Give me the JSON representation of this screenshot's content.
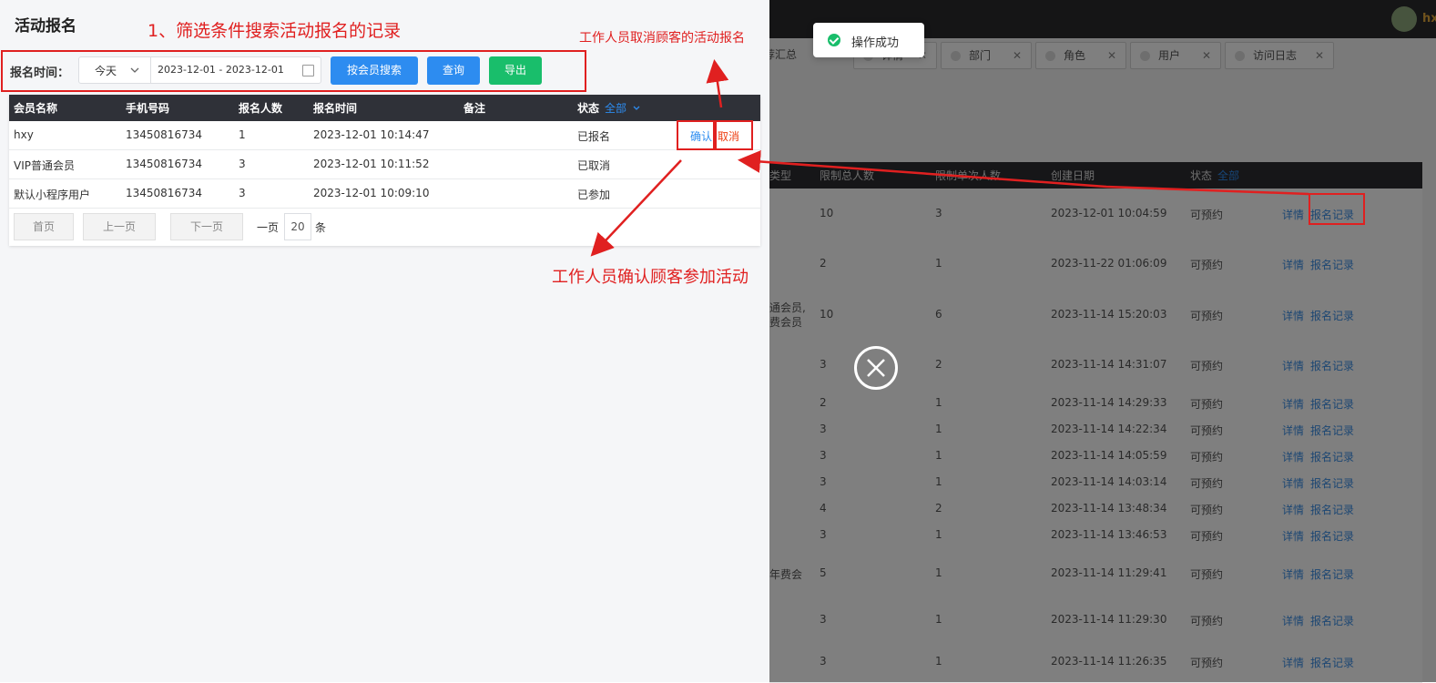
{
  "background_app": {
    "user_label": "hx",
    "toast_text": "操作成功",
    "tabs": [
      {
        "label": "荐汇总",
        "closable": false
      },
      {
        "label": "详情",
        "closable": true
      },
      {
        "label": "部门",
        "closable": true
      },
      {
        "label": "角色",
        "closable": true
      },
      {
        "label": "用户",
        "closable": true
      },
      {
        "label": "访问日志",
        "closable": true
      }
    ],
    "columns": [
      "类型",
      "限制总人数",
      "限制单次人数",
      "创建日期",
      "状态",
      "全部"
    ],
    "rows": [
      {
        "type": "",
        "total": "10",
        "single": "3",
        "date": "2023-12-01 10:04:59",
        "status": "可预约"
      },
      {
        "type": "",
        "total": "2",
        "single": "1",
        "date": "2023-11-22 01:06:09",
        "status": "可预约"
      },
      {
        "type": "通会员,\n费会员",
        "total": "10",
        "single": "6",
        "date": "2023-11-14 15:20:03",
        "status": "可预约"
      },
      {
        "type": "",
        "total": "3",
        "single": "2",
        "date": "2023-11-14 14:31:07",
        "status": "可预约"
      },
      {
        "type": "",
        "total": "2",
        "single": "1",
        "date": "2023-11-14 14:29:33",
        "status": "可预约"
      },
      {
        "type": "",
        "total": "3",
        "single": "1",
        "date": "2023-11-14 14:22:34",
        "status": "可预约"
      },
      {
        "type": "",
        "total": "3",
        "single": "1",
        "date": "2023-11-14 14:05:59",
        "status": "可预约"
      },
      {
        "type": "",
        "total": "3",
        "single": "1",
        "date": "2023-11-14 14:03:14",
        "status": "可预约"
      },
      {
        "type": "",
        "total": "4",
        "single": "2",
        "date": "2023-11-14 13:48:34",
        "status": "可预约"
      },
      {
        "type": "",
        "total": "3",
        "single": "1",
        "date": "2023-11-14 13:46:53",
        "status": "可预约"
      },
      {
        "type": "年费会",
        "total": "5",
        "single": "1",
        "date": "2023-11-14 11:29:41",
        "status": "可预约"
      },
      {
        "type": "",
        "total": "3",
        "single": "1",
        "date": "2023-11-14 11:29:30",
        "status": "可预约"
      },
      {
        "type": "",
        "total": "3",
        "single": "1",
        "date": "2023-11-14 11:26:35",
        "status": "可预约"
      }
    ],
    "row_actions": {
      "detail": "详情",
      "records": "报名记录"
    }
  },
  "drawer": {
    "title": "活动报名",
    "filter": {
      "label": "报名时间：",
      "range_option": "今天",
      "date_range": "2023-12-01 - 2023-12-01",
      "member_search_button": "按会员搜索",
      "query_button": "查询",
      "export_button": "导出"
    },
    "table": {
      "headers": {
        "member": "会员名称",
        "phone": "手机号码",
        "count": "报名人数",
        "time": "报名时间",
        "note": "备注",
        "status": "状态",
        "status_filter": "全部"
      },
      "rows": [
        {
          "member": "hxy",
          "phone": "13450816734",
          "count": "1",
          "time": "2023-12-01 10:14:47",
          "note": "",
          "status": "已报名",
          "confirm": "确认",
          "cancel": "取消"
        },
        {
          "member": "VIP普通会员",
          "phone": "13450816734",
          "count": "3",
          "time": "2023-12-01 10:11:52",
          "note": "",
          "status": "已取消"
        },
        {
          "member": "默认小程序用户",
          "phone": "13450816734",
          "count": "3",
          "time": "2023-12-01 10:09:10",
          "note": "",
          "status": "已参加"
        }
      ]
    },
    "pager": {
      "first": "首页",
      "prev": "上一页",
      "next": "下一页",
      "per_page_prefix": "一页",
      "page_size": "20",
      "per_page_suffix": "条"
    }
  },
  "annotations": {
    "filter_note": "1、筛选条件搜索活动报名的记录",
    "cancel_note": "工作人员取消顾客的活动报名",
    "confirm_note": "工作人员确认顾客参加活动"
  },
  "colors": {
    "primary": "#2d8cf0",
    "success": "#19be6b",
    "danger": "#ed4014",
    "annotation_red": "#e02020"
  }
}
